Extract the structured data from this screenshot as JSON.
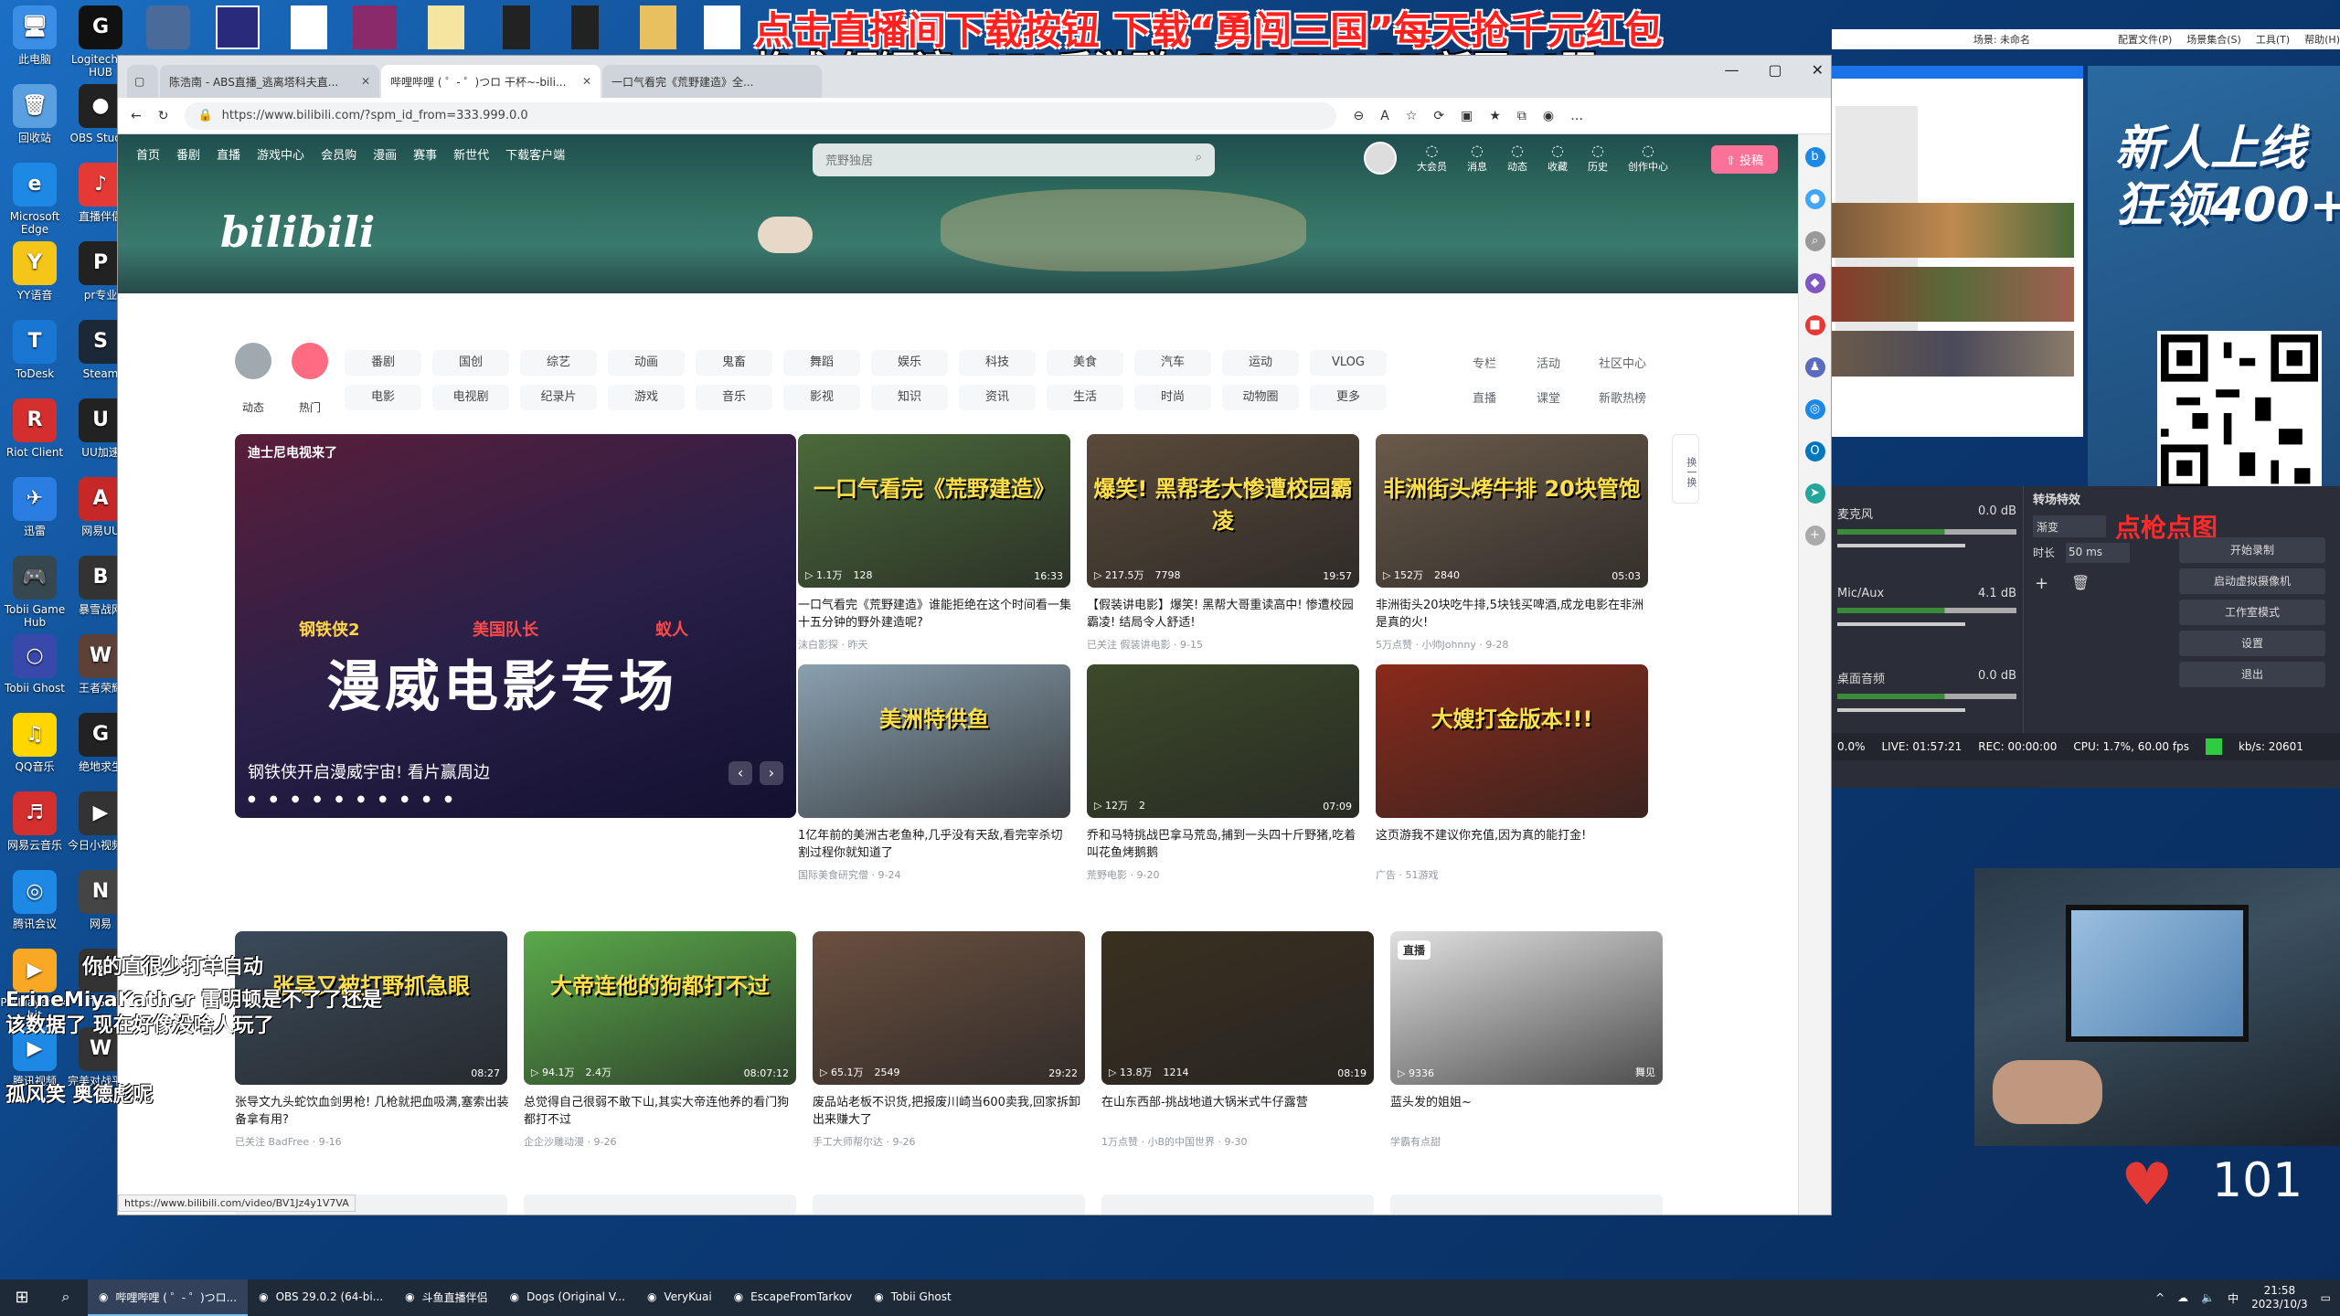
{
  "desktop": {
    "icons": [
      {
        "label": "此电脑",
        "color": "#3a8ee6",
        "glyph": "🖥"
      },
      {
        "label": "Logitech G HUB",
        "color": "#111",
        "glyph": "G"
      },
      {
        "label": "回收站",
        "color": "#5aa0e0",
        "glyph": "🗑"
      },
      {
        "label": "OBS Studio",
        "color": "#222",
        "glyph": "●"
      },
      {
        "label": "Microsoft Edge",
        "color": "#1e88e5",
        "glyph": "e"
      },
      {
        "label": "直播伴侣",
        "color": "#e53935",
        "glyph": "♪"
      },
      {
        "label": "YY语音",
        "color": "#f5c518",
        "glyph": "Y"
      },
      {
        "label": "pr专业",
        "color": "#222",
        "glyph": "P"
      },
      {
        "label": "ToDesk",
        "color": "#1976d2",
        "glyph": "T"
      },
      {
        "label": "Steam",
        "color": "#1b2838",
        "glyph": "S"
      },
      {
        "label": "Riot Client",
        "color": "#d32f2f",
        "glyph": "R"
      },
      {
        "label": "UU加速",
        "color": "#222",
        "glyph": "U"
      },
      {
        "label": "迅雷",
        "color": "#2a7de1",
        "glyph": "✈"
      },
      {
        "label": "网易UU",
        "color": "#c62828",
        "glyph": "A"
      },
      {
        "label": "Tobii Game Hub",
        "color": "#37474f",
        "glyph": "🎮"
      },
      {
        "label": "暴雪战网",
        "color": "#333",
        "glyph": "B"
      },
      {
        "label": "Tobii Ghost",
        "color": "#3949ab",
        "glyph": "○"
      },
      {
        "label": "王者荣耀",
        "color": "#5d4037",
        "glyph": "W"
      },
      {
        "label": "QQ音乐",
        "color": "#ffd600",
        "glyph": "♫"
      },
      {
        "label": "绝地求生",
        "color": "#222",
        "glyph": "G"
      },
      {
        "label": "网易云音乐",
        "color": "#d32f2f",
        "glyph": "♬"
      },
      {
        "label": "今日小视频呢",
        "color": "#333",
        "glyph": "▶"
      },
      {
        "label": "腾讯会议",
        "color": "#1e88e5",
        "glyph": "◎"
      },
      {
        "label": "网易",
        "color": "#444",
        "glyph": "N"
      },
      {
        "label": "PotPlayer 64 bit",
        "color": "#f9a825",
        "glyph": "▶"
      },
      {
        "label": "TGP",
        "color": "#333",
        "glyph": "T"
      },
      {
        "label": "腾讯视频",
        "color": "#1e88e5",
        "glyph": "▶"
      },
      {
        "label": "完美对战平台",
        "color": "#333",
        "glyph": "W"
      }
    ]
  },
  "overlay": {
    "red_line": "点击直播间下载按钮 下载“勇闯三国”每天抢千元红包",
    "white_line": "格式:铜锣湾、XX 手游群: 261857185 新区14服",
    "right_banner": "新人上线 狂领400+",
    "heart_count": "101",
    "danmu": [
      "你的直很少打羊自动",
      "ErineMiyaKather 雷明顿是不了了还是",
      "该数据了 现在好像没啥人玩了",
      "孤风笑 奥德彪呢"
    ],
    "obs_red_text": "点枪点图"
  },
  "browser": {
    "tabs": [
      {
        "label": "陈浩南 - ABS直播_逃离塔科夫直..."
      },
      {
        "label": "哔哩哔哩 ( ゜- ゜)つロ 干杯~-bili..."
      },
      {
        "label": "一口气看完《荒野建造》全..."
      }
    ],
    "url": "https://www.bilibili.com/?spm_id_from=333.999.0.0",
    "status_url": "https://www.bilibili.com/video/BV1Jz4y1V7VA"
  },
  "bili": {
    "nav": [
      "首页",
      "番剧",
      "直播",
      "游戏中心",
      "会员购",
      "漫画",
      "赛事",
      "新世代",
      "下载客户端"
    ],
    "search_placeholder": "荒野独居",
    "right_nav": [
      "大会员",
      "消息",
      "动态",
      "收藏",
      "历史",
      "创作中心"
    ],
    "upload": "投稿",
    "logo": "bilibili",
    "left_tabs": [
      "动态",
      "热门"
    ],
    "categories_row1": [
      "番剧",
      "国创",
      "综艺",
      "动画",
      "鬼畜",
      "舞蹈",
      "娱乐",
      "科技",
      "美食",
      "汽车",
      "运动",
      "VLOG"
    ],
    "categories_row2": [
      "电影",
      "电视剧",
      "纪录片",
      "游戏",
      "音乐",
      "影视",
      "知识",
      "资讯",
      "生活",
      "时尚",
      "动物圈",
      "更多"
    ],
    "side_links_row1": [
      "专栏",
      "活动",
      "社区中心"
    ],
    "side_links_row2": [
      "直播",
      "课堂",
      "新歌热榜"
    ],
    "refresh": "换一换",
    "hero": {
      "badge": "迪士尼电视来了",
      "title": "钢铁侠开启漫威宇宙! 看片赢周边",
      "big_text": "漫威电影专场",
      "sub_left": "钢铁侠2",
      "sub_mid": "美国队长",
      "sub_right": "蚁人"
    },
    "cards": [
      {
        "caption": "一口气看完《荒野建造》",
        "views": "1.1万",
        "danmu": "128",
        "duration": "16:33",
        "title": "一口气看完《荒野建造》谁能拒绝在这个时间看一集十五分钟的野外建造呢?",
        "meta": "沫白影探 · 昨天",
        "color": "#4b6a3a"
      },
      {
        "caption": "爆笑! 黑帮老大惨遭校园霸凌",
        "views": "217.5万",
        "danmu": "7798",
        "duration": "19:57",
        "title": "【假装讲电影】爆笑! 黑帮大哥重读高中! 惨遭校园霸凌! 结局令人舒适!",
        "meta": "已关注 假装讲电影 · 9-15",
        "color": "#5a4a3a"
      },
      {
        "caption": "非洲街头烤牛排 20块管饱",
        "views": "152万",
        "danmu": "2840",
        "duration": "05:03",
        "title": "非洲街头20块吃牛排,5块钱买啤酒,成龙电影在非洲是真的火!",
        "meta": "5万点赞 · 小帅Johnny · 9-28",
        "color": "#6a5a4a"
      },
      {
        "caption": "美洲特供鱼",
        "views": "",
        "danmu": "",
        "duration": "",
        "title": "1亿年前的美洲古老鱼种,几乎没有天敌,看完宰杀切割过程你就知道了",
        "meta": "国际美食研究僧 · 9-24",
        "color": "#8aa0b0"
      },
      {
        "caption": "",
        "views": "12万",
        "danmu": "2",
        "duration": "07:09",
        "title": "乔和马特挑战巴拿马荒岛,捕到一头四十斤野猪,吃着叫花鱼烤鹅鹅",
        "meta": "荒野电影 · 9-20",
        "color": "#3d4a2a"
      },
      {
        "caption": "大嫂打金版本!!!",
        "views": "",
        "danmu": "",
        "duration": "",
        "title": "这页游我不建议你充值,因为真的能打金!",
        "meta": "广告 · 51游戏",
        "color": "#8a2a1a"
      },
      {
        "caption": "张导又被打野抓急眼",
        "views": "",
        "danmu": "",
        "duration": "08:27",
        "title": "张导文九头蛇饮血剑男枪! 几枪就把血吸满,塞索出装备拿有用?",
        "meta": "已关注 BadFree · 9-16",
        "color": "#3a4a5a"
      },
      {
        "caption": "大帝连他的狗都打不过",
        "views": "94.1万",
        "danmu": "2.4万",
        "duration": "08:07:12",
        "title": "总觉得自己很弱不敢下山,其实大帝连他养的看门狗都打不过",
        "meta": "企企沙雕动漫 · 9-26",
        "color": "#5aaa4a"
      },
      {
        "caption": "",
        "views": "65.1万",
        "danmu": "2549",
        "duration": "29:22",
        "title": "废品站老板不识货,把报废川崎当600卖我,回家拆卸出来赚大了",
        "meta": "手工大师帮尔达 · 9-26",
        "color": "#6a5040"
      },
      {
        "caption": "",
        "views": "13.8万",
        "danmu": "1214",
        "duration": "08:19",
        "title": "在山东西部-挑战地道大锅米式牛仔露营",
        "meta": "1万点赞 · 小B的中国世界 · 9-30",
        "color": "#3a3020"
      },
      {
        "caption": "直播",
        "views": "9336",
        "danmu": "",
        "duration": "舞见",
        "title": "蓝头发的姐姐~",
        "meta": "学霸有点甜",
        "color": "#e0e0e0"
      }
    ]
  },
  "obs": {
    "menu": [
      "配置文件(P)",
      "场景集合(S)",
      "工具(T)",
      "帮助(H)"
    ],
    "title_right": "场景: 未命名",
    "transition_title": "转场特效",
    "fade": "渐变",
    "duration_label": "时长",
    "duration_val": "50 ms",
    "mixer": [
      {
        "name": "麦克风",
        "db": "0.0 dB"
      },
      {
        "name": "Mic/Aux",
        "db": "4.1 dB"
      },
      {
        "name": "桌面音频",
        "db": "0.0 dB"
      }
    ],
    "controls": [
      "开始录制",
      "启动虚拟摄像机",
      "工作室模式",
      "设置",
      "退出"
    ],
    "status": {
      "dropped": "0.0%",
      "live": "LIVE: 01:57:21",
      "rec": "REC: 00:00:00",
      "cpu": "CPU: 1.7%, 60.00 fps",
      "kbs": "kb/s: 20601"
    }
  },
  "taskbar": {
    "items": [
      {
        "label": "哔哩哔哩 ( ゜- ゜)つロ...",
        "active": true
      },
      {
        "label": "OBS 29.0.2 (64-bi...",
        "active": false
      },
      {
        "label": "斗鱼直播伴侣",
        "active": false
      },
      {
        "label": "Dogs (Original V...",
        "active": false
      },
      {
        "label": "VeryKuai",
        "active": false
      },
      {
        "label": "EscapeFromTarkov",
        "active": false
      },
      {
        "label": "Tobii Ghost",
        "active": false
      }
    ],
    "time": "21:58",
    "date": "2023/10/3",
    "ime": "中"
  }
}
